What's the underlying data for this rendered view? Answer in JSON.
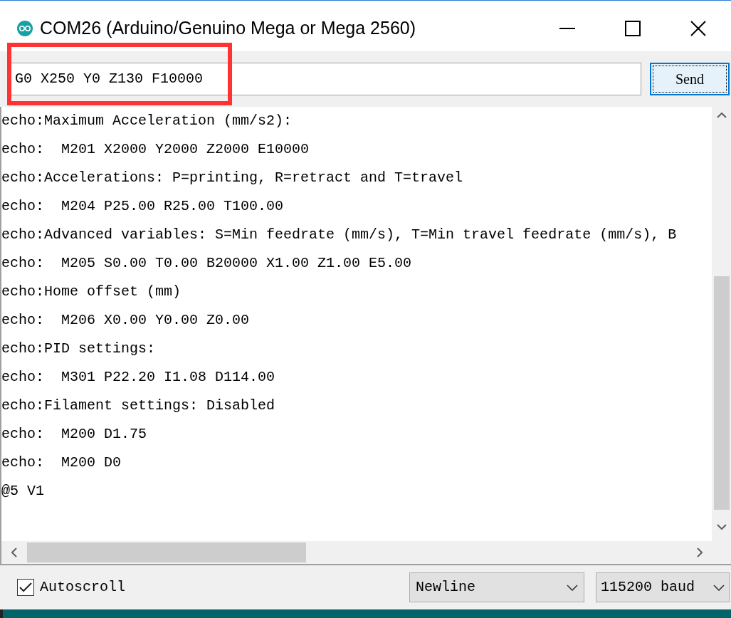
{
  "window": {
    "title": "COM26 (Arduino/Genuino Mega or Mega 2560)"
  },
  "command": {
    "value": "G0 X250 Y0 Z130 F10000",
    "highlighted": true
  },
  "send_button": "Send",
  "output_lines": [
    "echo:Maximum Acceleration (mm/s2):",
    "echo:  M201 X2000 Y2000 Z2000 E10000",
    "echo:Accelerations: P=printing, R=retract and T=travel",
    "echo:  M204 P25.00 R25.00 T100.00",
    "echo:Advanced variables: S=Min feedrate (mm/s), T=Min travel feedrate (mm/s), B",
    "echo:  M205 S0.00 T0.00 B20000 X1.00 Z1.00 E5.00",
    "echo:Home offset (mm)",
    "echo:  M206 X0.00 Y0.00 Z0.00",
    "echo:PID settings:",
    "echo:  M301 P22.20 I1.08 D114.00",
    "echo:Filament settings: Disabled",
    "echo:  M200 D1.75",
    "echo:  M200 D0",
    "@5 V1"
  ],
  "autoscroll": {
    "label": "Autoscroll",
    "checked": true
  },
  "line_ending": "Newline",
  "baud_rate": "115200 baud"
}
